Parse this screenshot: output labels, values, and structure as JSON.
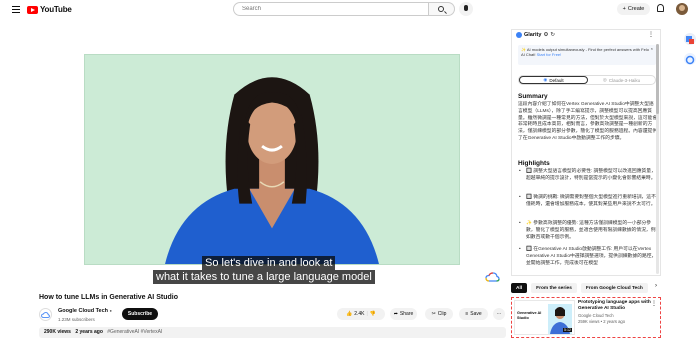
{
  "header": {
    "logo_text": "YouTube",
    "search_placeholder": "Search",
    "create_label": "Create"
  },
  "video": {
    "caption_line1": "So let's dive in and look at",
    "caption_line2": "what it takes to tune a large language model",
    "title": "How to tune LLMs in Generative AI Studio",
    "channel_name": "Google Cloud Tech",
    "subscribers": "1.23M subscribers",
    "subscribe_label": "Subscribe",
    "likes": "2.4K",
    "share_label": "Share",
    "clip_label": "Clip",
    "save_label": "Save",
    "more_label": "···",
    "views_text": "290K views",
    "age_text": "2 years ago",
    "tags": "#GenerativeAI #VertexAI"
  },
  "glarity": {
    "title": "Glarity",
    "promo_text": "✨ AI models output simultaneously - Find the perfect answers with Felo AI Chat!",
    "promo_link": "Start for Free!",
    "tabs": [
      {
        "label": "Default",
        "active": true
      },
      {
        "label": "Claude-3-Haiku",
        "active": false
      }
    ],
    "summary_title": "Summary",
    "summary_text": "這段內容介紹了如何在Vertex Generative AI Studio中調整大型語言模型（LLMs），除了手工編寫提示，調整模型可以提高回應質量。雖然微調是一種常見的方法，但對於大型模型來說，這可能會非常耗時且成本高昂，相對而言，參數高效調整是一種創新的方法，僅訓練模型的部分參數，簡化了模型的服務過程。內容還提供了在Generative AI Studio中啟動調整工作的步驟。",
    "highlights_title": "Highlights",
    "highlights": [
      "🔲 調整大型語言模型的必要性: 調整模型可以改進回應質量，超越單純的提示設計，特別是當提示的小變化會影響結果時。",
      "🔲 微調的挑戰: 微調需要對整個大型模型進行重新培訓，這不僅耗時，還會增加服務成本，使其對某些用戶來說不太可行。",
      "✨ 參數高效調整的優勢: 這種方法僅訓練模型的一小部分參數，簡化了模型的服務，並適合使用有限訓練數據的情況，例如數百或數千個示例。",
      "🔲 在Generative AI Studio啟動調整工作: 用戶可以在Vertex Generative AI Studio中選擇調整選項，提供訓練數據的路徑，並開始調整工作，完成後可在模型"
    ]
  },
  "related": {
    "chips": [
      "All",
      "From the series",
      "From Google Cloud Tech"
    ],
    "card": {
      "thumb_text": "Generative AI Studio",
      "duration": "5:12",
      "title": "Prototyping language apps with Generative AI Studio",
      "channel": "Google Cloud Tech",
      "stats": "259K views • 2 years ago"
    }
  },
  "colors": {
    "youtube_red": "#ff0000",
    "screen_green": "#ccebd6",
    "glarity_blue": "#3b82f6"
  }
}
